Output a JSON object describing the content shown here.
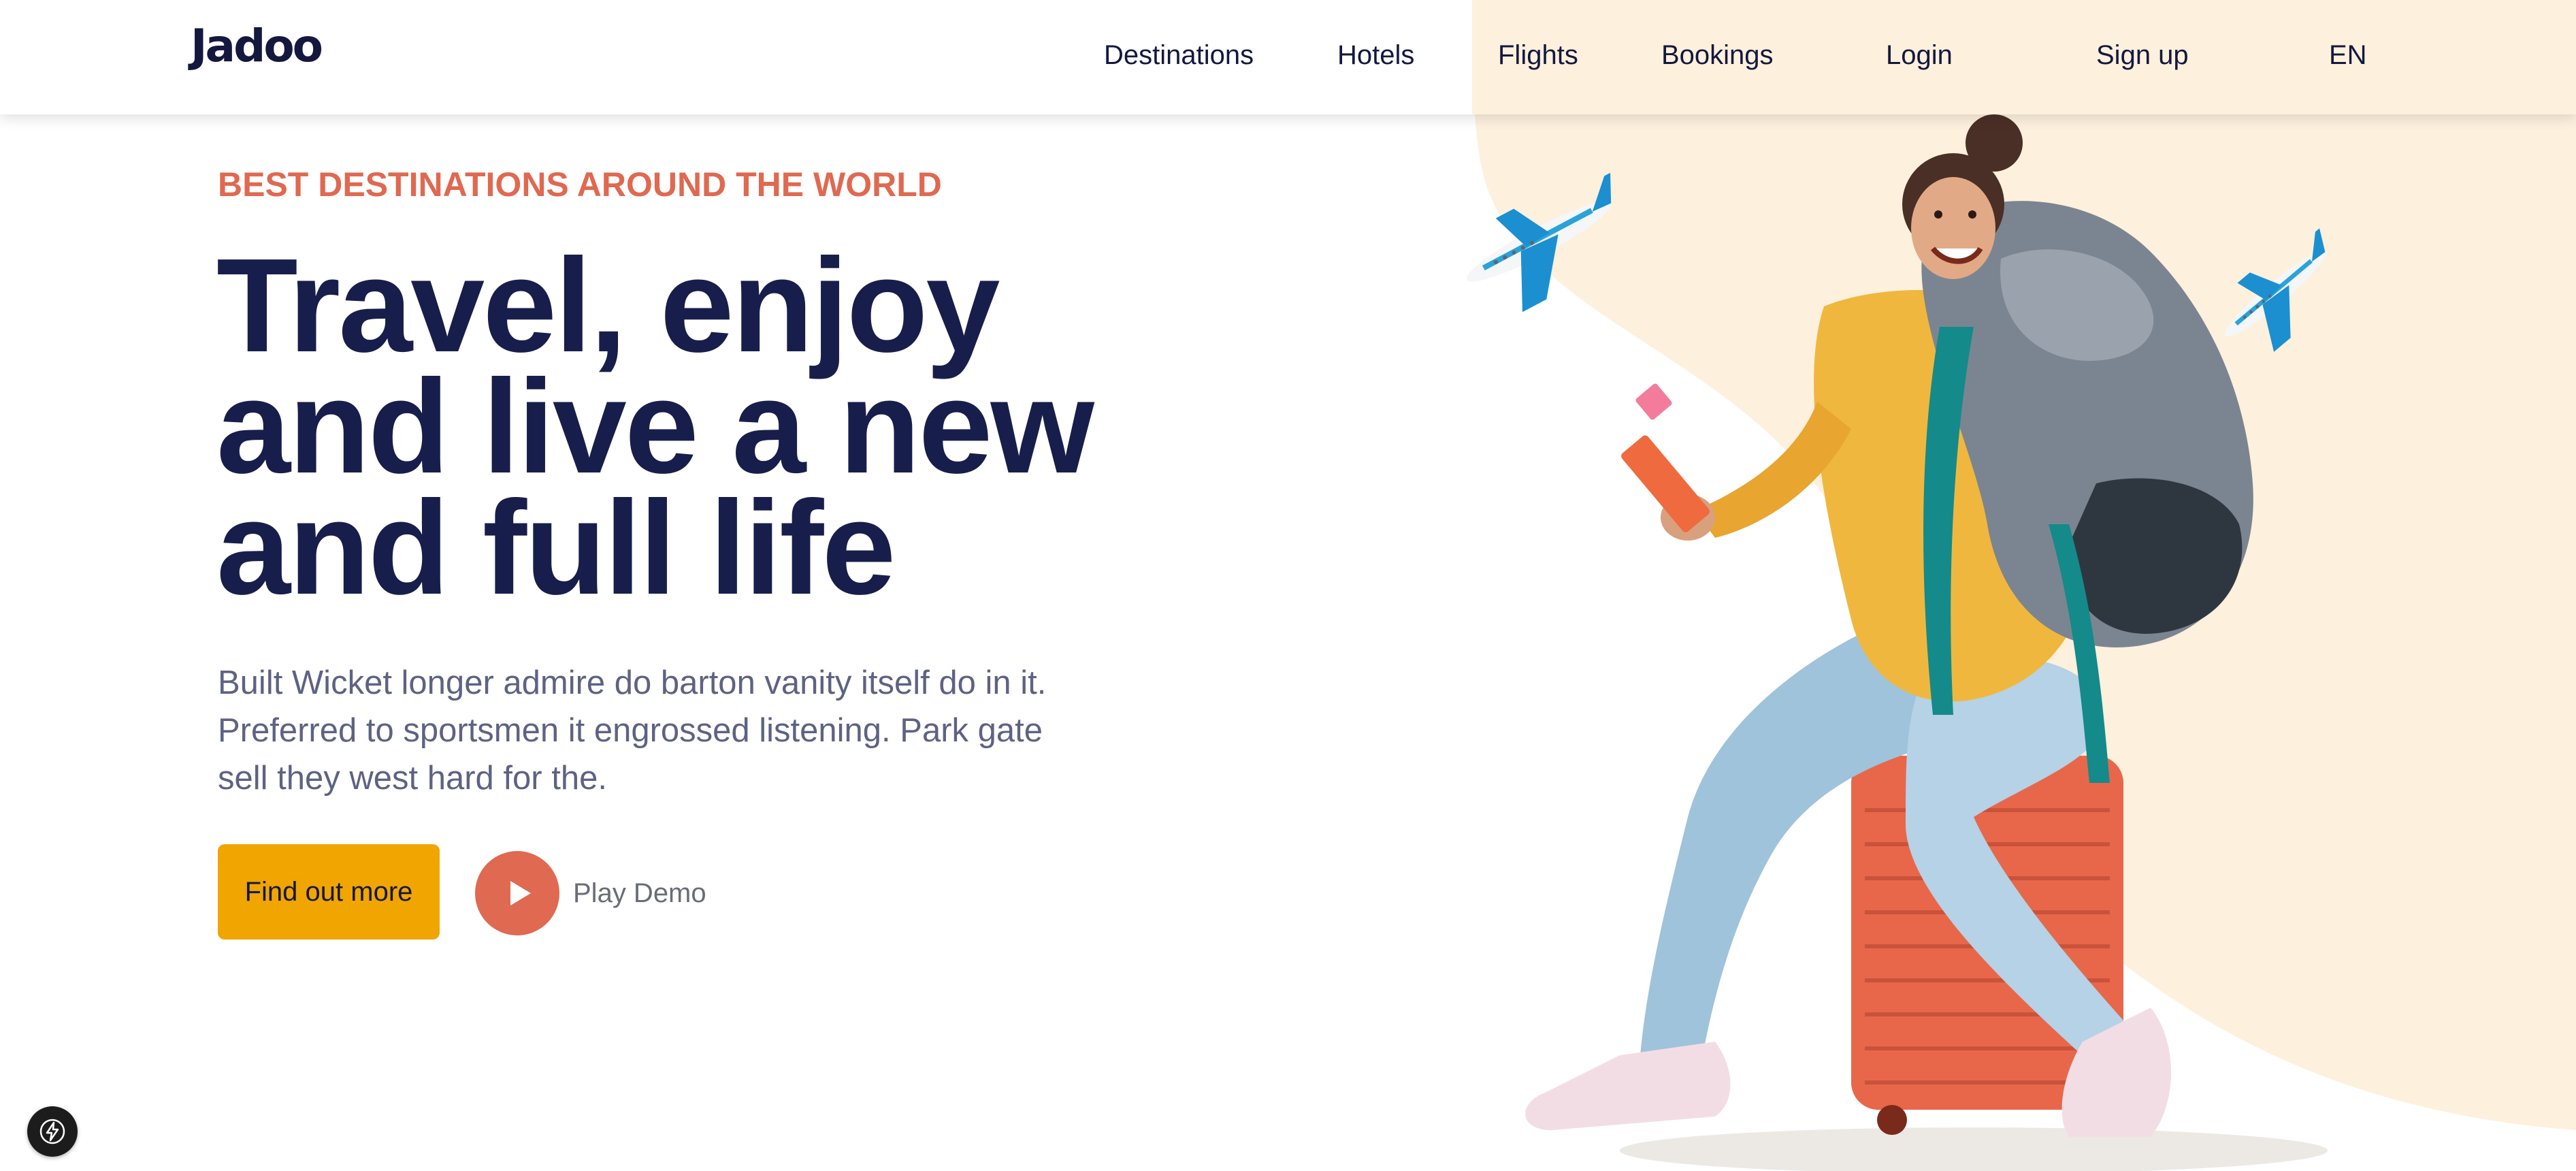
{
  "brand": {
    "logo_text": "Jadoo"
  },
  "nav": {
    "items": [
      {
        "label": "Destinations"
      },
      {
        "label": "Hotels"
      },
      {
        "label": "Flights"
      },
      {
        "label": "Bookings"
      },
      {
        "label": "Login"
      },
      {
        "label": "Sign up"
      },
      {
        "label": "EN"
      }
    ]
  },
  "hero": {
    "eyebrow": "BEST DESTINATIONS AROUND THE WORLD",
    "headline_lines": [
      "Travel, enjoy",
      "and live a new",
      "and full life"
    ],
    "description_lines": [
      "Built Wicket longer admire do barton vanity itself do in it.",
      "Preferred to sportsmen it engrossed listening. Park gate",
      "sell they west hard for the."
    ],
    "cta_label": "Find out more",
    "play_label": "Play Demo"
  },
  "colors": {
    "primary_text": "#181e4b",
    "accent_orange": "#df6951",
    "accent_yellow": "#f1a501",
    "cream": "#fdf0dd",
    "muted_text": "#5e6282"
  },
  "icons": {
    "play": "play-icon",
    "plane": "airplane-icon",
    "dev_tools": "lightning-icon"
  }
}
